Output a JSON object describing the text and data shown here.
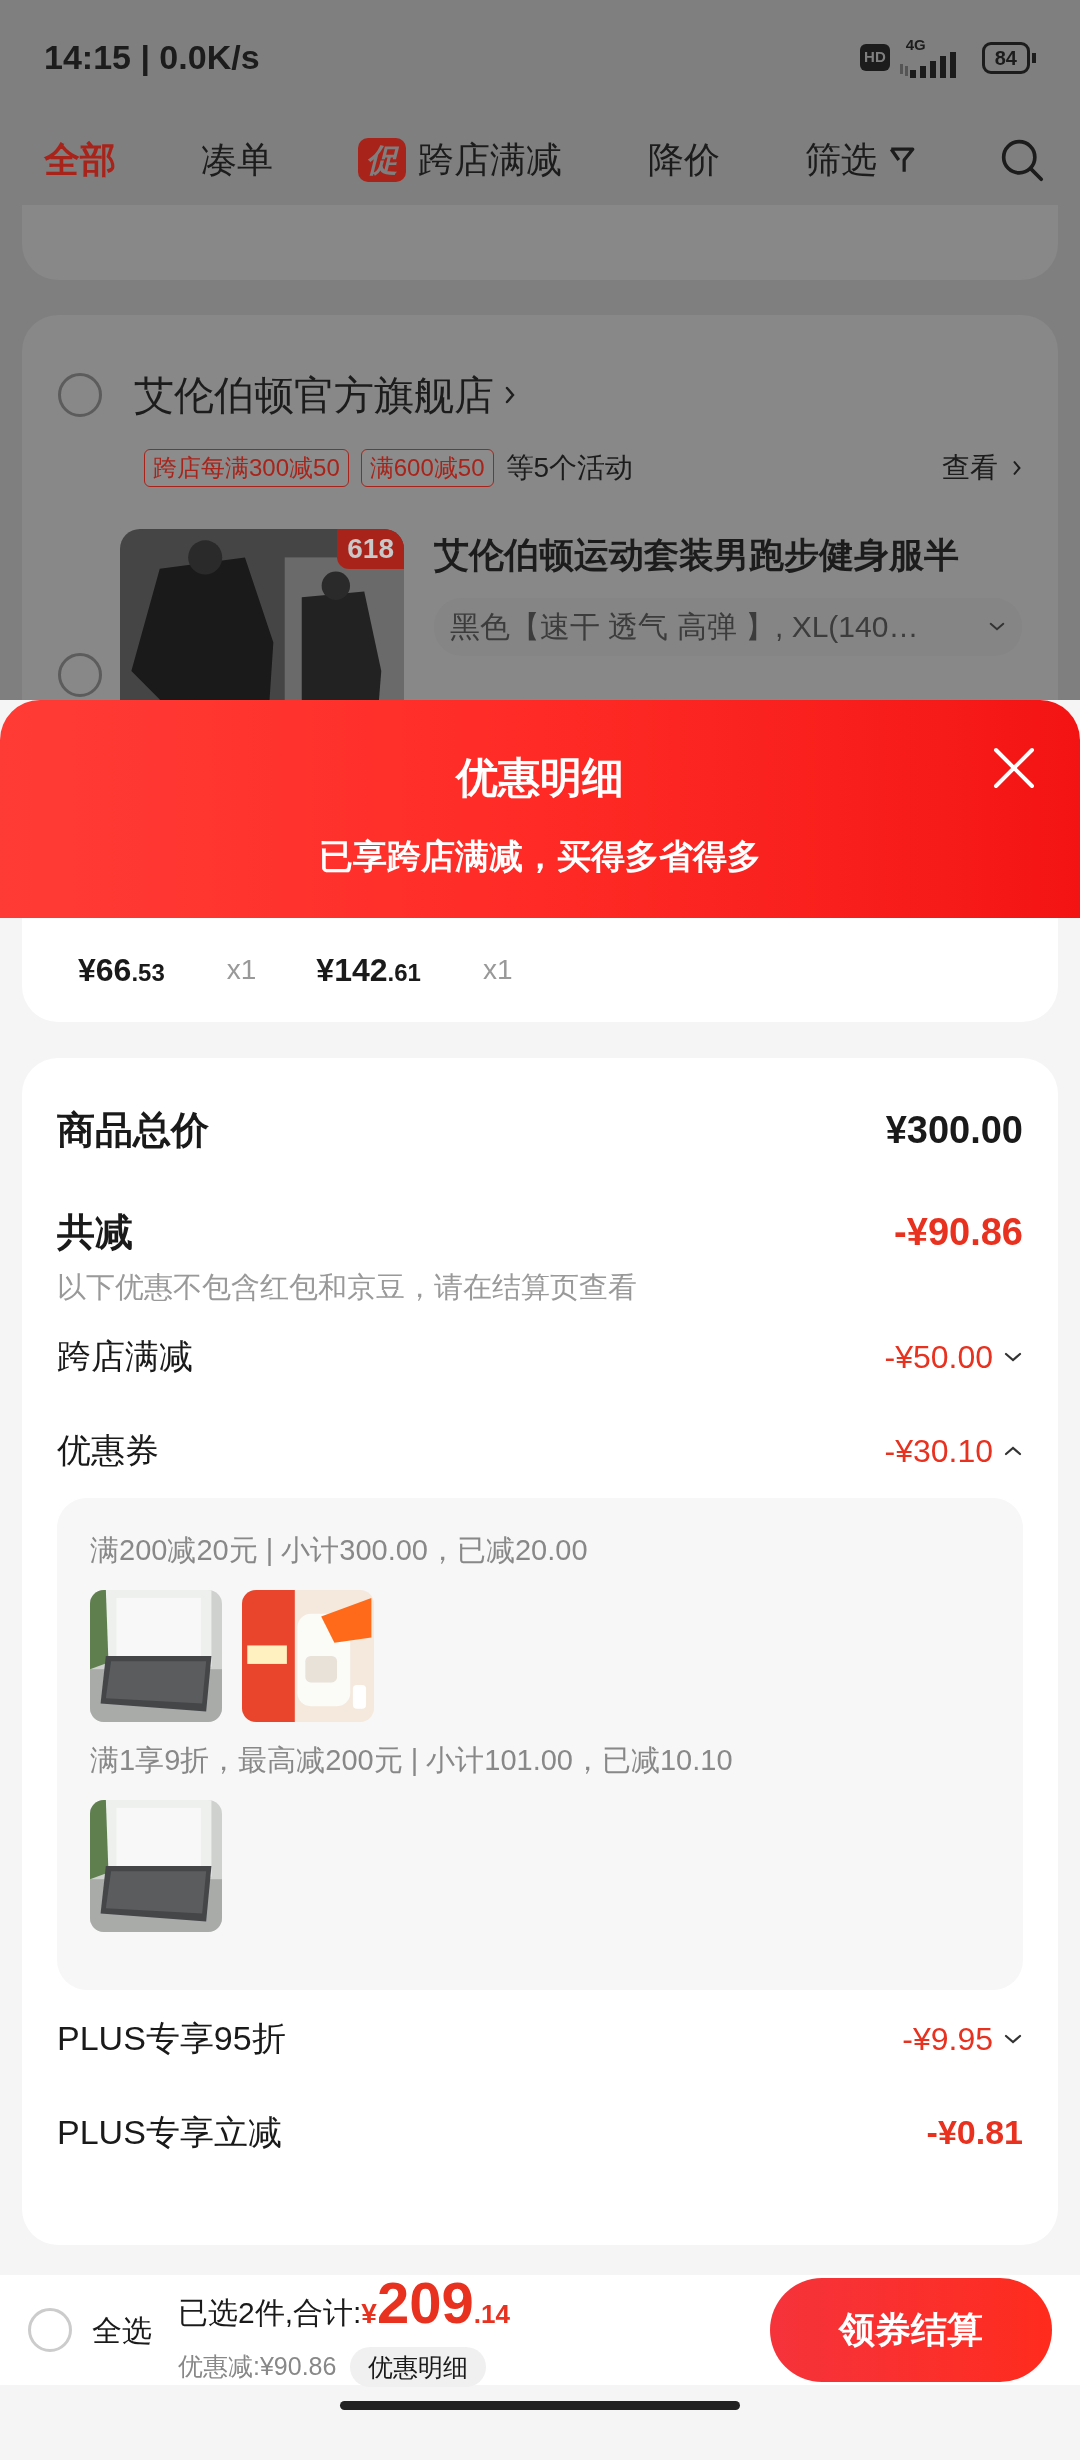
{
  "status_bar": {
    "time": "14:15 | 0.0K/s",
    "hd": "HD",
    "network": "4G",
    "battery": "84"
  },
  "tabs": [
    {
      "label": "全部",
      "selected": true
    },
    {
      "label": "凑单",
      "selected": false
    },
    {
      "label": "跨店满减",
      "badge": "促",
      "selected": false
    },
    {
      "label": "降价",
      "selected": false
    },
    {
      "label": "筛选",
      "selected": false
    }
  ],
  "store": {
    "name": "艾伦伯顿官方旗舰店",
    "selected": false,
    "tags": [
      "跨店每满300减50",
      "满600减50"
    ],
    "activity_note": "等5个活动",
    "view_link": "查看",
    "product": {
      "selected": false,
      "badge": "618",
      "title": "艾伦伯顿运动套装男跑步健身服半",
      "spec": "黑色【速干 透气  高弹 】, XL(140…"
    }
  },
  "sheet": {
    "title": "优惠明细",
    "subtitle": "已享跨店满减，买得多省得多",
    "items": [
      {
        "price": "¥66",
        "decimals": ".53",
        "qty": "x1"
      },
      {
        "price": "¥142",
        "decimals": ".61",
        "qty": "x1"
      }
    ],
    "total_label": "商品总价",
    "total": "¥300.00",
    "reduce_label": "共减",
    "reduce": "-¥90.86",
    "note": "以下优惠不包含红包和京豆，请在结算页查看",
    "discounts": [
      {
        "kind": "expandable",
        "label": "跨店满减",
        "amount": "-¥50.00",
        "expanded": false
      },
      {
        "kind": "expandable",
        "label": "优惠券",
        "amount": "-¥30.10",
        "expanded": true,
        "groups": [
          {
            "rule": "满200减20元 | 小计300.00，已减20.00"
          },
          {
            "rule": "满1享9折，最高减200元 | 小计101.00，已减10.10"
          }
        ]
      },
      {
        "kind": "expandable",
        "label": "PLUS专享95折",
        "amount": "-¥9.95",
        "expanded": false
      },
      {
        "kind": "plain",
        "label": "PLUS专享立减",
        "amount": "-¥0.81"
      }
    ]
  },
  "footer": {
    "select_all": {
      "label": "全选",
      "checked": false
    },
    "summary": "已选2件,合计:",
    "currency": "¥",
    "total_integer": "209",
    "total_decimals": ".14",
    "savings": "优惠减:¥90.86",
    "details_button": "优惠明细",
    "checkout": "领券结算"
  }
}
